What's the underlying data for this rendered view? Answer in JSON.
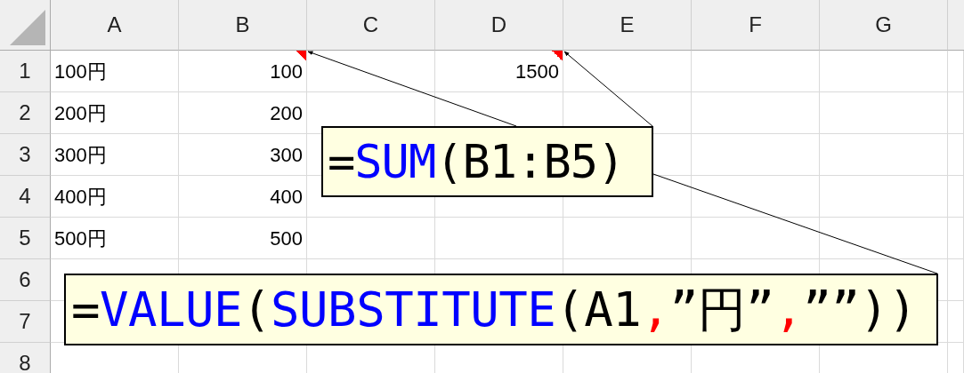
{
  "columns": [
    "A",
    "B",
    "C",
    "D",
    "E",
    "F",
    "G"
  ],
  "rows": [
    {
      "number": "1",
      "cells": [
        {
          "kind": "text",
          "text": "100円",
          "has_comment": false
        },
        {
          "kind": "number",
          "text": "100",
          "has_comment": true
        },
        null,
        {
          "kind": "number",
          "text": "1500",
          "has_comment": true
        },
        null,
        null,
        null
      ]
    },
    {
      "number": "2",
      "cells": [
        {
          "kind": "text",
          "text": "200円",
          "has_comment": false
        },
        {
          "kind": "number",
          "text": "200",
          "has_comment": false
        },
        null,
        null,
        null,
        null,
        null
      ]
    },
    {
      "number": "3",
      "cells": [
        {
          "kind": "text",
          "text": "300円",
          "has_comment": false
        },
        {
          "kind": "number",
          "text": "300",
          "has_comment": false
        },
        null,
        null,
        null,
        null,
        null
      ]
    },
    {
      "number": "4",
      "cells": [
        {
          "kind": "text",
          "text": "400円",
          "has_comment": false
        },
        {
          "kind": "number",
          "text": "400",
          "has_comment": false
        },
        null,
        null,
        null,
        null,
        null
      ]
    },
    {
      "number": "5",
      "cells": [
        {
          "kind": "text",
          "text": "500円",
          "has_comment": false
        },
        {
          "kind": "number",
          "text": "500",
          "has_comment": false
        },
        null,
        null,
        null,
        null,
        null
      ]
    },
    {
      "number": "6"
    },
    {
      "number": "7"
    },
    {
      "number": "8"
    }
  ],
  "callouts": [
    {
      "segments": [
        {
          "text": "=",
          "color": "#000000"
        },
        {
          "text": "SUM",
          "color": "#0000ff"
        },
        {
          "text": "(B1:B5)",
          "color": "#000000"
        }
      ]
    },
    {
      "segments": [
        {
          "text": "=",
          "color": "#000000"
        },
        {
          "text": "VALUE",
          "color": "#0000ff"
        },
        {
          "text": "(",
          "color": "#000000"
        },
        {
          "text": "SUBSTITUTE",
          "color": "#0000ff"
        },
        {
          "text": "(A1",
          "color": "#000000"
        },
        {
          "text": ",",
          "color": "#ff0000"
        },
        {
          "text": "”円”",
          "color": "#000000"
        },
        {
          "text": ",",
          "color": "#ff0000"
        },
        {
          "text": "””))",
          "color": "#000000"
        }
      ]
    }
  ]
}
